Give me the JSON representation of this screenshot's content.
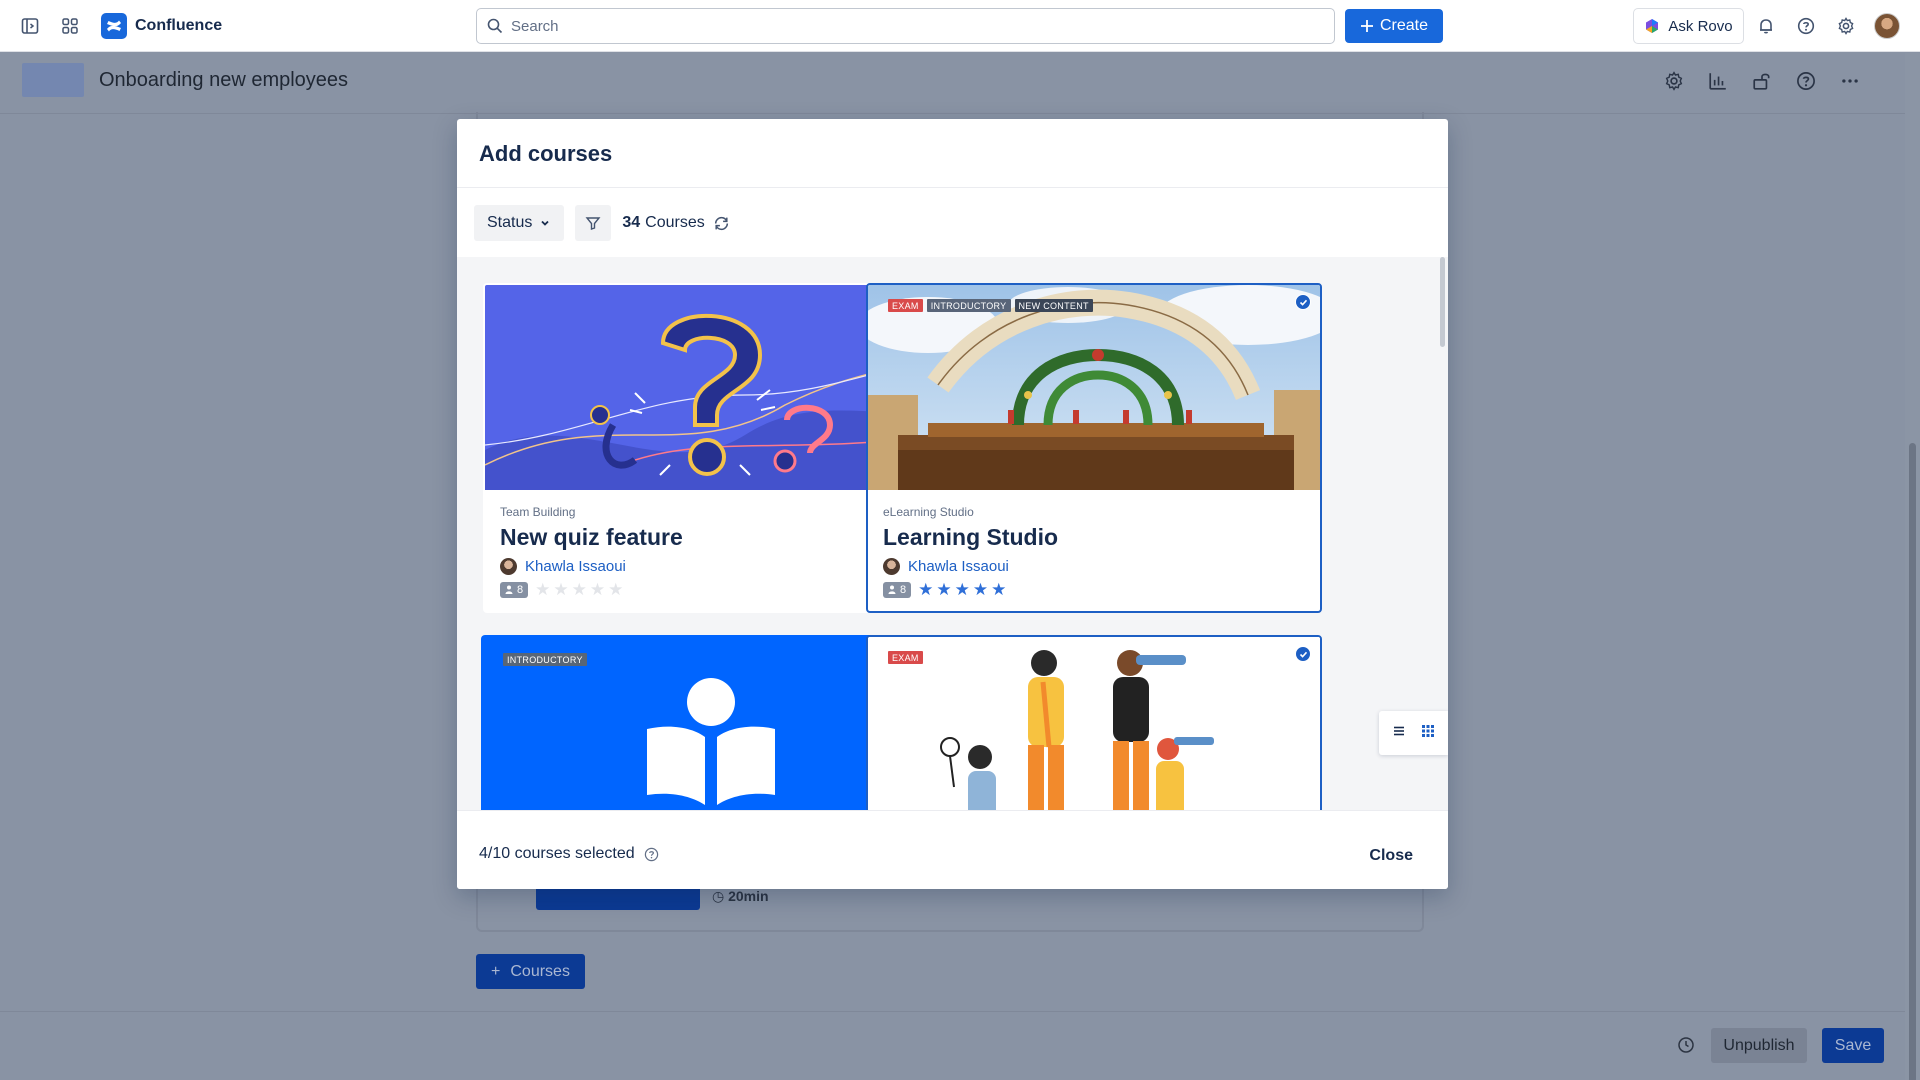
{
  "topnav": {
    "brand": "Confluence",
    "search_placeholder": "Search",
    "create_label": "Create",
    "ask_rovo_label": "Ask Rovo"
  },
  "page": {
    "title": "Onboarding new employees",
    "bg_duration": "20min",
    "courses_button": "Courses",
    "unpublish_label": "Unpublish",
    "save_label": "Save"
  },
  "modal": {
    "title": "Add courses",
    "status_label": "Status",
    "course_count": "34",
    "course_count_label": "Courses",
    "selected_text": "4/10 courses selected",
    "close_label": "Close",
    "cards": [
      {
        "category": "Team Building",
        "title": "New quiz feature",
        "author": "Khawla Issaoui",
        "enrolled": "8",
        "rating": 0,
        "selected": false,
        "tags": []
      },
      {
        "category": "eLearning Studio",
        "title": "Learning Studio",
        "author": "Khawla Issaoui",
        "enrolled": "8",
        "rating": 5,
        "selected": true,
        "tags": [
          "EXAM",
          "INTRODUCTORY",
          "NEW CONTENT"
        ]
      },
      {
        "selected": false,
        "tags": [
          "INTRODUCTORY"
        ]
      },
      {
        "selected": true,
        "tags": [
          "EXAM"
        ]
      }
    ]
  },
  "colors": {
    "accent": "#1868db",
    "selected_border": "#1d5fc4",
    "tag_exam": "#d94a4a",
    "tag_intro": "#596579"
  },
  "icons": [
    "sidebar-toggle-icon",
    "app-switcher-icon",
    "search-icon",
    "plus-icon",
    "rovo-icon",
    "bell-icon",
    "help-icon",
    "settings-icon",
    "chevron-down-icon",
    "filter-icon",
    "refresh-icon",
    "check-icon",
    "list-view-icon",
    "grid-view-icon",
    "info-icon",
    "history-icon"
  ]
}
